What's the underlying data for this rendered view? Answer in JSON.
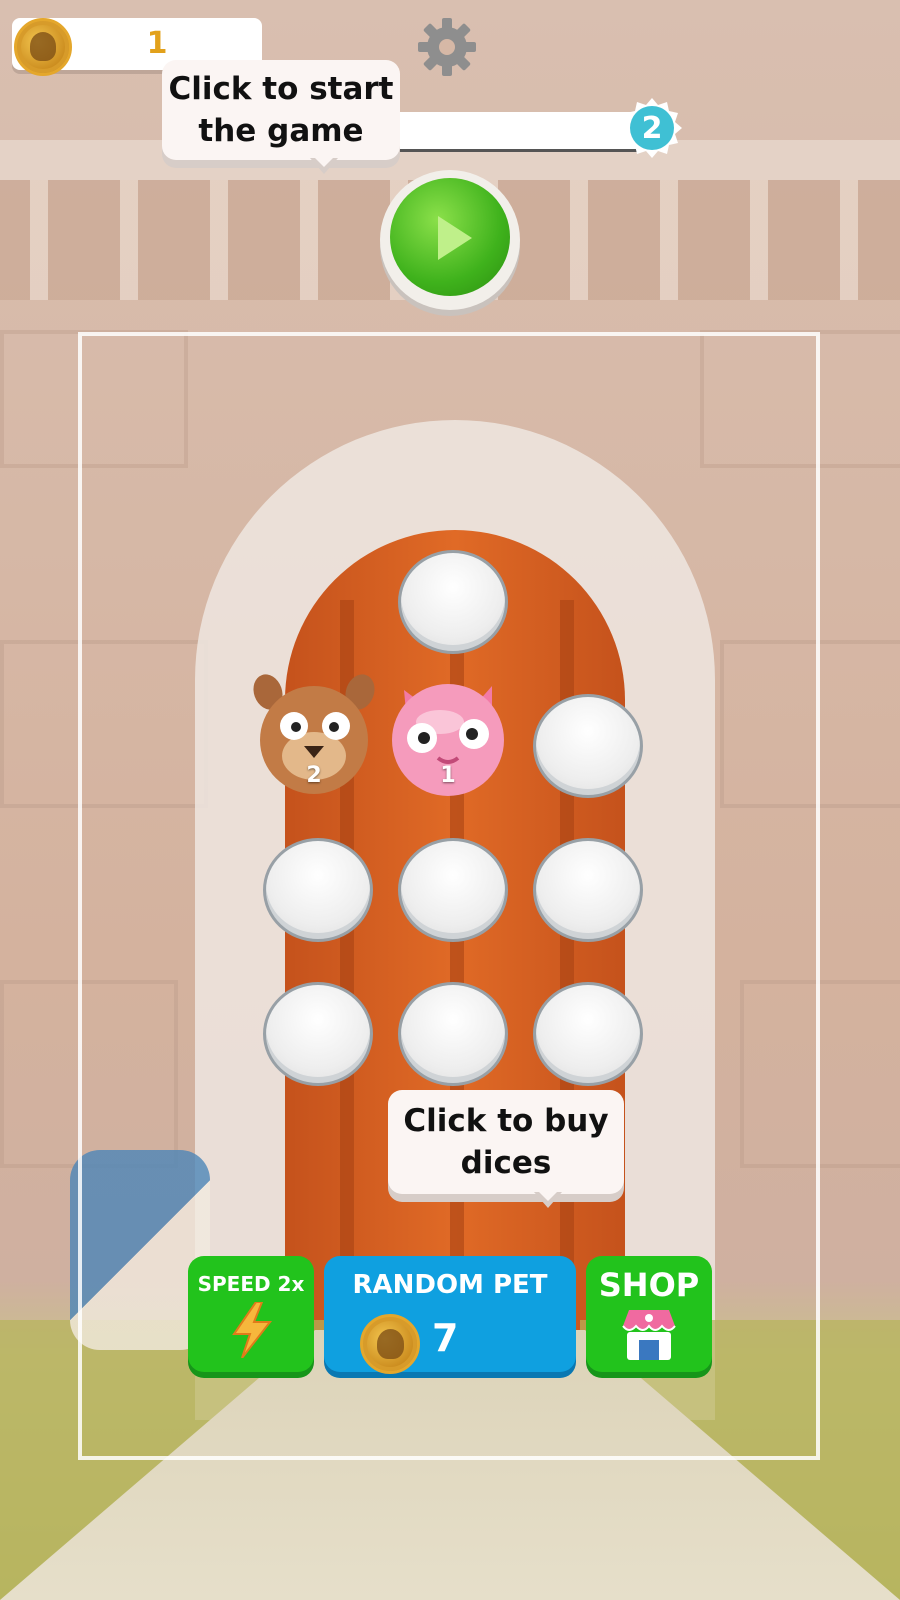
{
  "hud": {
    "coin_count": "1",
    "level_next": "2",
    "icons": {
      "coin": "skull-coin-icon",
      "settings": "gear-icon"
    }
  },
  "tooltips": {
    "start_line1": "Click to start",
    "start_line2": "the game",
    "buy_line1": "Click to buy",
    "buy_line2": "dices"
  },
  "board": {
    "pets": [
      {
        "name": "dog",
        "level": "2"
      },
      {
        "name": "pig",
        "level": "1"
      }
    ]
  },
  "buttons": {
    "speed_label": "SPEED 2x",
    "random_label": "RANDOM PET",
    "random_cost": "7",
    "shop_label": "SHOP"
  },
  "colors": {
    "green_button": "#22c31c",
    "blue_button": "#0fa0e0",
    "coin_text": "#e2a11b",
    "level_badge": "#3fc0d4"
  }
}
